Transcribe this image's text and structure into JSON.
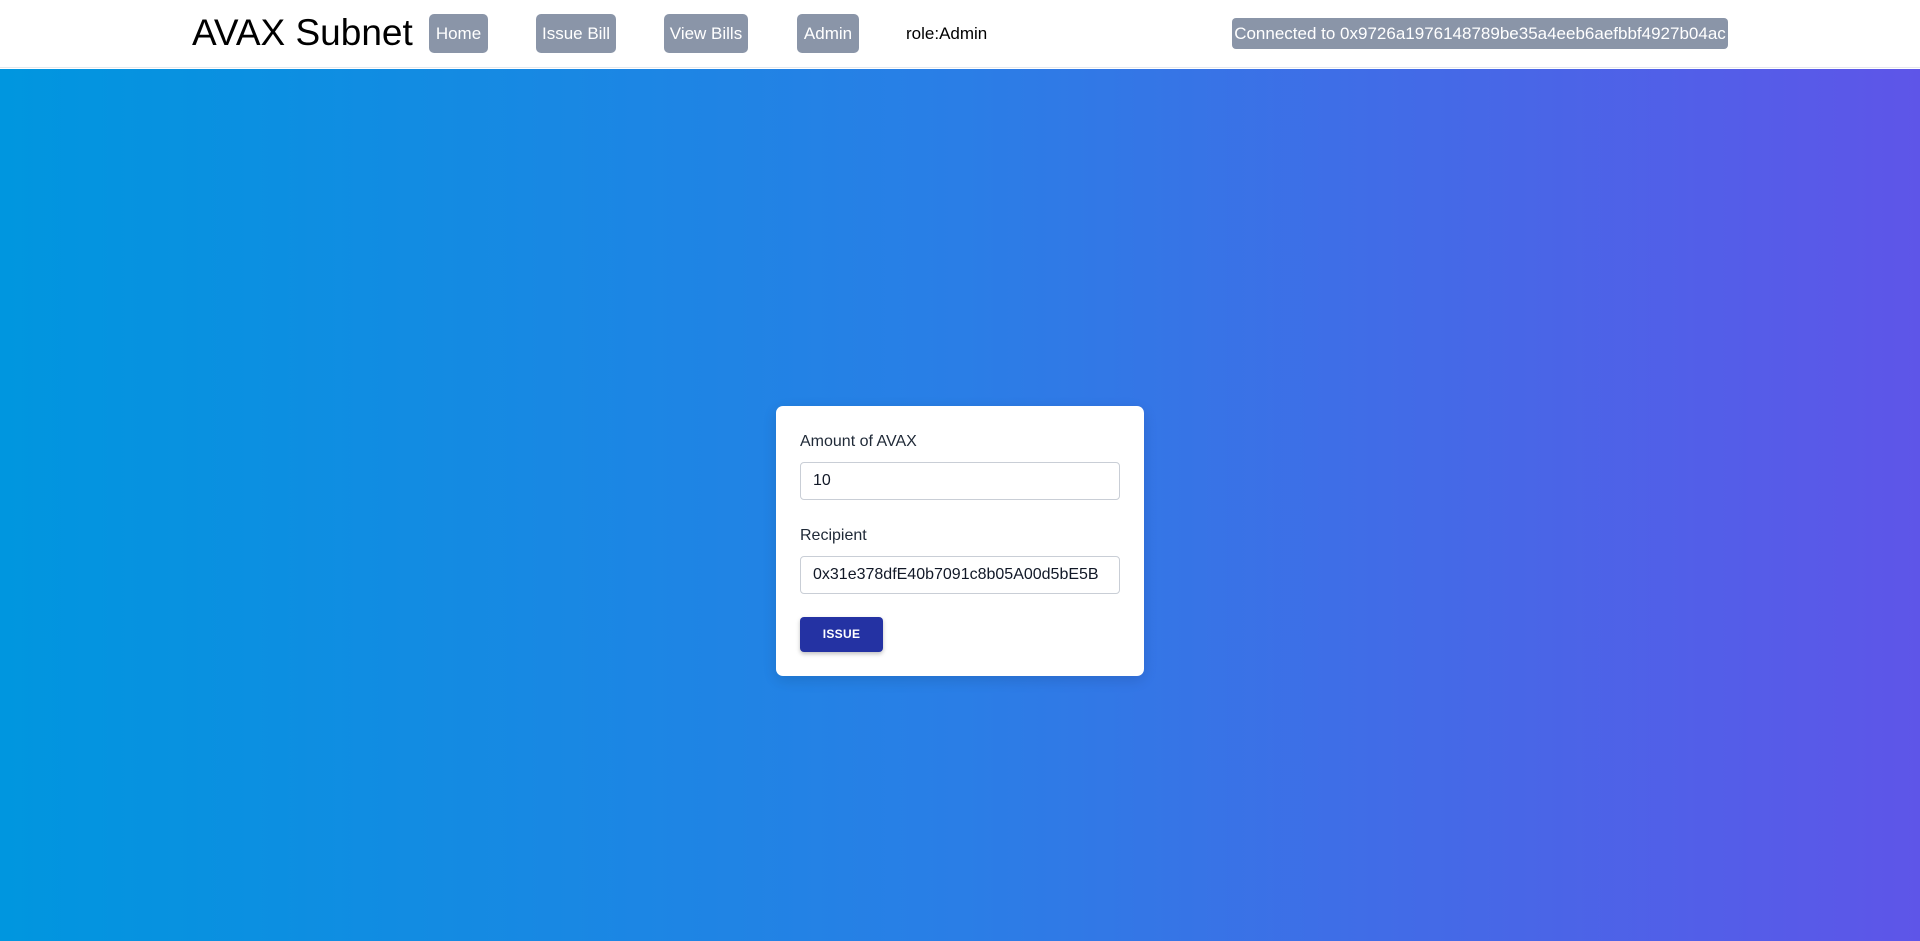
{
  "navbar": {
    "brand": "AVAX Subnet",
    "links": {
      "home": "Home",
      "issue_bill": "Issue Bill",
      "view_bills": "View Bills",
      "admin": "Admin"
    },
    "role": "role:Admin",
    "connection": "Connected to 0x9726a1976148789be35a4eeb6aefbbf4927b04ac"
  },
  "form": {
    "amount_label": "Amount of AVAX",
    "amount_value": "10",
    "recipient_label": "Recipient",
    "recipient_value": "0x31e378dfE40b7091c8b05A00d5bE5B",
    "submit_label": "ISSUE"
  },
  "colors": {
    "nav_button": "#8a95a8",
    "primary_button": "#2432a3",
    "gradient_start": "#0096df",
    "gradient_end": "#5e55e8"
  }
}
